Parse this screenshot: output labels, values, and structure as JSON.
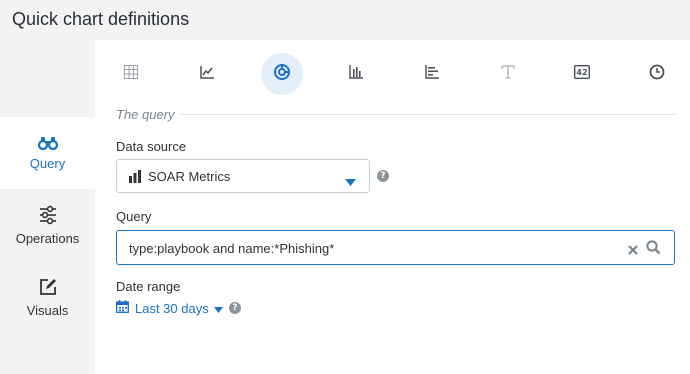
{
  "header": {
    "title": "Quick chart definitions"
  },
  "sidebar": {
    "items": [
      {
        "label": "Query",
        "icon": "binoculars-icon",
        "active": true
      },
      {
        "label": "Operations",
        "icon": "sliders-icon",
        "active": false
      },
      {
        "label": "Visuals",
        "icon": "edit-icon",
        "active": false
      }
    ]
  },
  "chart_types": [
    {
      "icon": "table-icon",
      "active": false
    },
    {
      "icon": "line-chart-icon",
      "active": false
    },
    {
      "icon": "donut-chart-icon",
      "active": true
    },
    {
      "icon": "bar-chart-icon",
      "active": false
    },
    {
      "icon": "horizontal-bar-chart-icon",
      "active": false
    },
    {
      "icon": "text-icon",
      "active": false
    },
    {
      "icon": "number-icon",
      "active": false
    },
    {
      "icon": "clock-icon",
      "active": false
    }
  ],
  "query_section": {
    "title": "The query",
    "data_source": {
      "label": "Data source",
      "value": "SOAR Metrics"
    },
    "query": {
      "label": "Query",
      "value": "type:playbook and name:*Phishing*"
    },
    "date_range": {
      "label": "Date range",
      "value": "Last 30 days"
    }
  },
  "colors": {
    "accent": "#1a72c4",
    "sidebar_bg": "#f2f3f4",
    "active_chart_bg": "#e3eef8"
  }
}
